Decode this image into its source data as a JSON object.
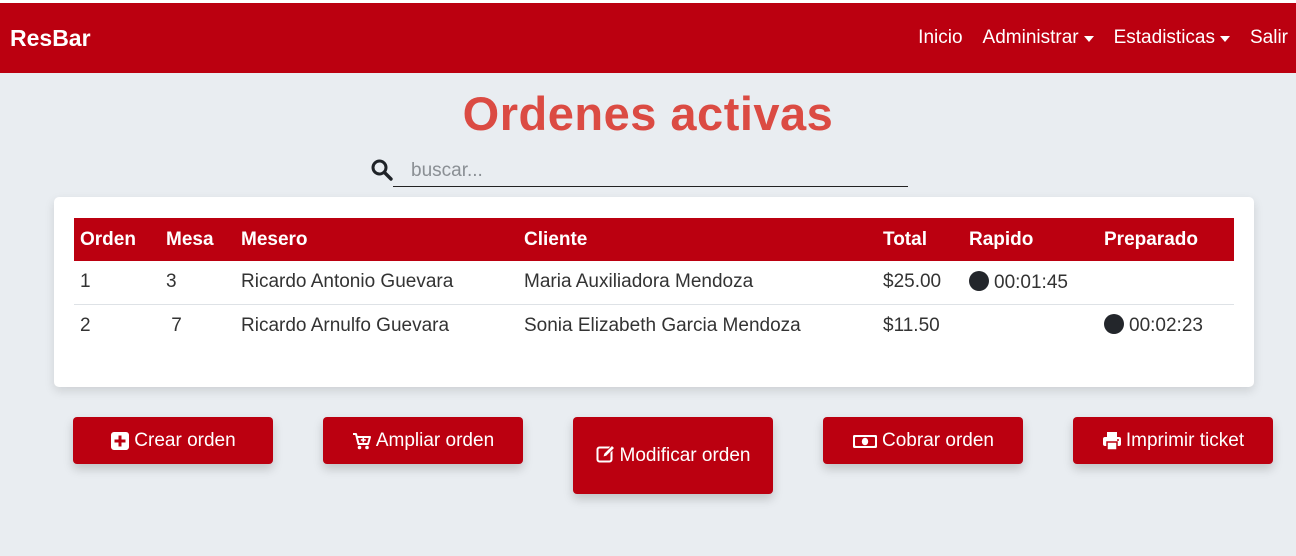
{
  "navbar": {
    "brand": "ResBar",
    "links": [
      {
        "label": "Inicio",
        "dropdown": false
      },
      {
        "label": "Administrar",
        "dropdown": true
      },
      {
        "label": "Estadisticas",
        "dropdown": true
      },
      {
        "label": "Salir",
        "dropdown": false
      }
    ]
  },
  "page": {
    "title": "Ordenes activas"
  },
  "search": {
    "placeholder": "buscar...",
    "value": ""
  },
  "table": {
    "headers": [
      "Orden",
      "Mesa",
      "Mesero",
      "Cliente",
      "Total",
      "Rapido",
      "Preparado"
    ],
    "rows": [
      {
        "orden": "1",
        "mesa": "3",
        "mesero": "Ricardo Antonio Guevara",
        "cliente": "Maria Auxiliadora Mendoza",
        "total": "$25.00",
        "rapido": "00:01:45",
        "preparado": ""
      },
      {
        "orden": "2",
        "mesa": " 7",
        "mesero": "Ricardo Arnulfo Guevara",
        "cliente": "Sonia Elizabeth Garcia Mendoza",
        "total": "$11.50",
        "rapido": "",
        "preparado": "00:02:23"
      }
    ]
  },
  "actions": {
    "crear": {
      "label": "Crear orden",
      "icon": "plus-square-icon"
    },
    "ampliar": {
      "label": "Ampliar orden",
      "icon": "cart-plus-icon"
    },
    "modificar": {
      "label": "Modificar orden",
      "icon": "edit-icon"
    },
    "cobrar": {
      "label": "Cobrar orden",
      "icon": "money-bill-icon"
    },
    "imprimir": {
      "label": "Imprimir ticket",
      "icon": "print-icon"
    }
  },
  "colors": {
    "primary": "#bb0010",
    "title": "#db4b43",
    "background": "#e9edf1"
  }
}
